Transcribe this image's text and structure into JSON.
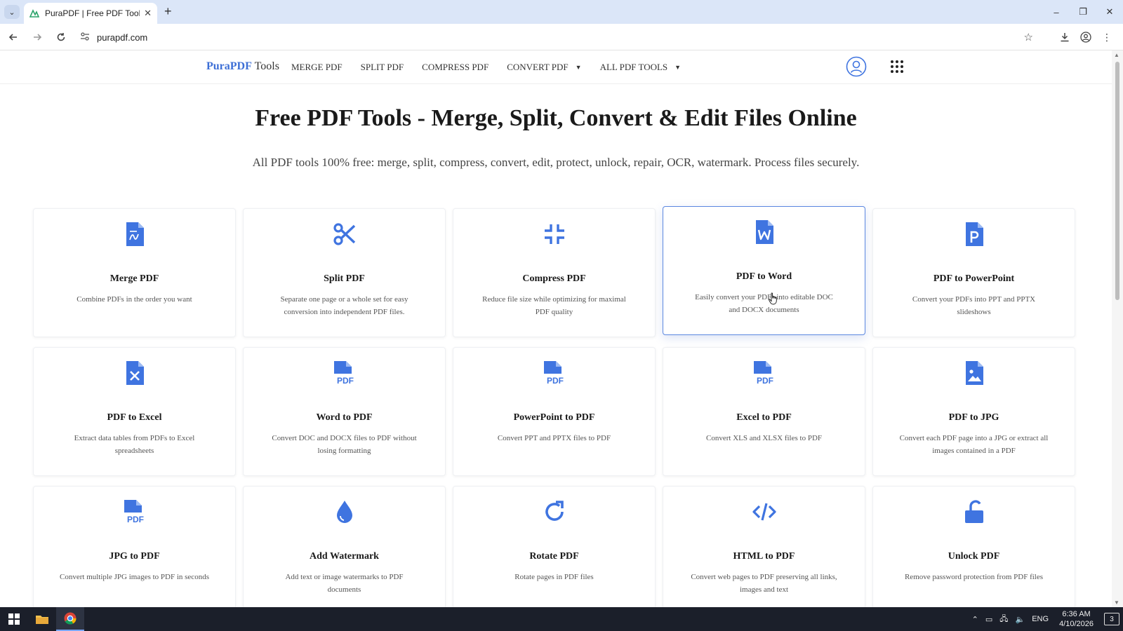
{
  "browser": {
    "tab_title": "PuraPDF | Free PDF Tools - Mer",
    "tab_close": "✕",
    "new_tab": "+",
    "url": "purapdf.com",
    "window_controls": [
      "–",
      "❐",
      "✕"
    ]
  },
  "header": {
    "brand_primary": "PuraPDF",
    "brand_secondary": "Tools",
    "nav": [
      {
        "label": "MERGE PDF"
      },
      {
        "label": "SPLIT PDF"
      },
      {
        "label": "COMPRESS PDF"
      },
      {
        "label": "CONVERT PDF"
      },
      {
        "label": "ALL PDF TOOLS"
      }
    ],
    "caret": "▼"
  },
  "hero": {
    "title": "Free PDF Tools - Merge, Split, Convert & Edit Files Online",
    "subtitle": "All PDF tools 100% free: merge, split, compress, convert, edit, protect, unlock, repair, OCR, watermark. Process files securely."
  },
  "tools": [
    {
      "title": "Merge PDF",
      "desc": "Combine PDFs in the order you want",
      "icon": "merge-icon"
    },
    {
      "title": "Split PDF",
      "desc": "Separate one page or a whole set for easy conversion into independent PDF files.",
      "icon": "scissors-icon"
    },
    {
      "title": "Compress PDF",
      "desc": "Reduce file size while optimizing for maximal PDF quality",
      "icon": "compress-icon"
    },
    {
      "title": "PDF to Word",
      "desc": "Easily convert your PDFs into editable DOC and DOCX documents",
      "icon": "word-file-icon"
    },
    {
      "title": "PDF to PowerPoint",
      "desc": "Convert your PDFs into PPT and PPTX slideshows",
      "icon": "powerpoint-file-icon"
    },
    {
      "title": "PDF to Excel",
      "desc": "Extract data tables from PDFs to Excel spreadsheets",
      "icon": "excel-file-icon"
    },
    {
      "title": "Word to PDF",
      "desc": "Convert DOC and DOCX files to PDF without losing formatting",
      "icon": "pdf-file-icon"
    },
    {
      "title": "PowerPoint to PDF",
      "desc": "Convert PPT and PPTX files to PDF",
      "icon": "pdf-file-icon"
    },
    {
      "title": "Excel to PDF",
      "desc": "Convert XLS and XLSX files to PDF",
      "icon": "pdf-file-icon"
    },
    {
      "title": "PDF to JPG",
      "desc": "Convert each PDF page into a JPG or extract all images contained in a PDF",
      "icon": "image-file-icon"
    },
    {
      "title": "JPG to PDF",
      "desc": "Convert multiple JPG images to PDF in seconds",
      "icon": "pdf-file-icon"
    },
    {
      "title": "Add Watermark",
      "desc": "Add text or image watermarks to PDF documents",
      "icon": "droplet-icon"
    },
    {
      "title": "Rotate PDF",
      "desc": "Rotate pages in PDF files",
      "icon": "rotate-icon"
    },
    {
      "title": "HTML to PDF",
      "desc": "Convert web pages to PDF preserving all links, images and text",
      "icon": "code-icon"
    },
    {
      "title": "Unlock PDF",
      "desc": "Remove password protection from PDF files",
      "icon": "unlock-icon"
    }
  ],
  "taskbar": {
    "language": "ENG",
    "time": "6:36 AM",
    "date": "4/10/2026",
    "notifications": "3"
  },
  "colors": {
    "accent": "#3d6fd6",
    "icon_blue": "#3f74e0"
  }
}
